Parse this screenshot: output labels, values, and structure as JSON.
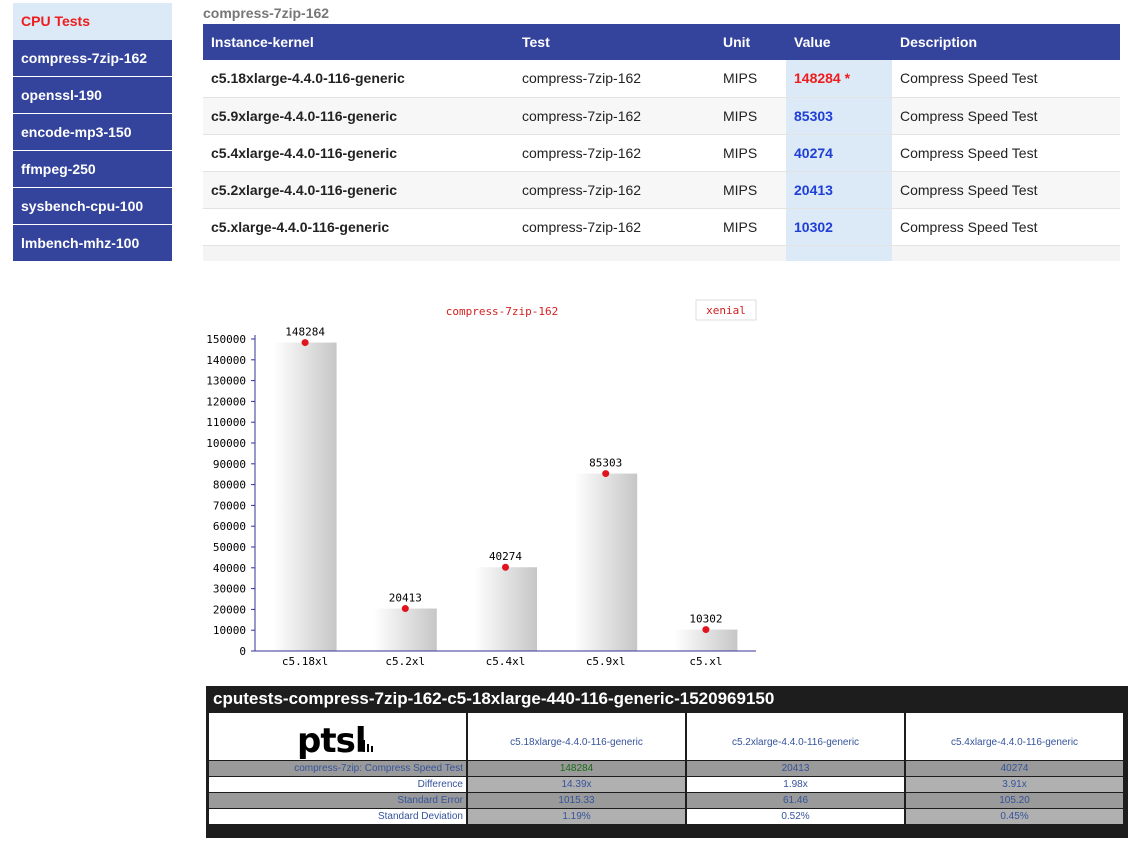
{
  "sidebar": {
    "heading": "CPU Tests",
    "items": [
      {
        "label": "compress-7zip-162"
      },
      {
        "label": "openssl-190"
      },
      {
        "label": "encode-mp3-150"
      },
      {
        "label": "ffmpeg-250"
      },
      {
        "label": "sysbench-cpu-100"
      },
      {
        "label": "lmbench-mhz-100"
      }
    ]
  },
  "section_title": "compress-7zip-162",
  "results": {
    "headers": [
      "Instance-kernel",
      "Test",
      "Unit",
      "Value",
      "Description"
    ],
    "rows": [
      {
        "instance": "c5.18xlarge-4.4.0-116-generic",
        "test": "compress-7zip-162",
        "unit": "MIPS",
        "value": "148284 *",
        "description": "Compress Speed Test"
      },
      {
        "instance": "c5.9xlarge-4.4.0-116-generic",
        "test": "compress-7zip-162",
        "unit": "MIPS",
        "value": "85303",
        "description": "Compress Speed Test"
      },
      {
        "instance": "c5.4xlarge-4.4.0-116-generic",
        "test": "compress-7zip-162",
        "unit": "MIPS",
        "value": "40274",
        "description": "Compress Speed Test"
      },
      {
        "instance": "c5.2xlarge-4.4.0-116-generic",
        "test": "compress-7zip-162",
        "unit": "MIPS",
        "value": "20413",
        "description": "Compress Speed Test"
      },
      {
        "instance": "c5.xlarge-4.4.0-116-generic",
        "test": "compress-7zip-162",
        "unit": "MIPS",
        "value": "10302",
        "description": "Compress Speed Test"
      }
    ],
    "best_color": "#ee1c1c",
    "value_color": "#1f3ed6"
  },
  "chart_data": {
    "type": "bar",
    "title": "compress-7zip-162",
    "legend": "xenial",
    "legend_position": "top-right",
    "categories": [
      "c5.18xl",
      "c5.2xl",
      "c5.4xl",
      "c5.9xl",
      "c5.xl"
    ],
    "values": [
      148284,
      20413,
      40274,
      85303,
      10302
    ],
    "ylim": [
      0,
      150000
    ],
    "yticks": [
      0,
      10000,
      20000,
      30000,
      40000,
      50000,
      60000,
      70000,
      80000,
      90000,
      100000,
      110000,
      120000,
      130000,
      140000,
      150000
    ],
    "xlabel": "",
    "ylabel": "",
    "grid": false
  },
  "pts": {
    "title": "cputests-compress-7zip-162-c5-18xlarge-440-116-generic-1520969150",
    "logo_text": "ptsl",
    "columns": [
      "c5.18xlarge-4.4.0-116-generic",
      "c5.2xlarge-4.4.0-116-generic",
      "c5.4xlarge-4.4.0-116-generic"
    ],
    "rows": [
      {
        "label": "compress-7zip: Compress Speed Test",
        "values": [
          "148284",
          "20413",
          "40274"
        ]
      },
      {
        "label": "Difference",
        "values": [
          "14.39x",
          "1.98x",
          "3.91x"
        ]
      },
      {
        "label": "Standard Error",
        "values": [
          "1015.33",
          "61.46",
          "105.20"
        ]
      },
      {
        "label": "Standard Deviation",
        "values": [
          "1.19%",
          "0.52%",
          "0.45%"
        ]
      }
    ]
  }
}
